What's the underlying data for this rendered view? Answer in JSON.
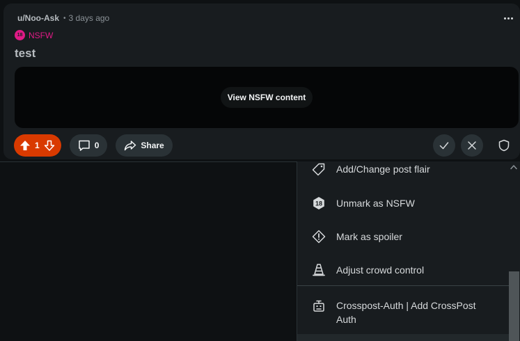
{
  "post": {
    "author": "u/Noo-Ask",
    "separator": "•",
    "time_ago": "3 days ago",
    "nsfw_badge": "18",
    "nsfw_label": "NSFW",
    "title": "test",
    "view_nsfw_label": "View NSFW content"
  },
  "actions": {
    "vote_count": "1",
    "comment_count": "0",
    "share_label": "Share"
  },
  "mod_menu": {
    "items": [
      {
        "label": "Add/Change post flair",
        "icon": "tag-icon"
      },
      {
        "label": "Unmark as NSFW",
        "icon": "nsfw-18-icon",
        "badge": "18"
      },
      {
        "label": "Mark as spoiler",
        "icon": "alert-icon"
      },
      {
        "label": "Adjust crowd control",
        "icon": "traffic-cone-icon"
      },
      {
        "label": "Crosspost-Auth | Add CrossPost Auth",
        "icon": "bot-icon"
      }
    ]
  },
  "colors": {
    "upvote_accent": "#d93a00",
    "nsfw_pink": "#e01a86",
    "background": "#0e1113",
    "card": "#181c1f"
  }
}
